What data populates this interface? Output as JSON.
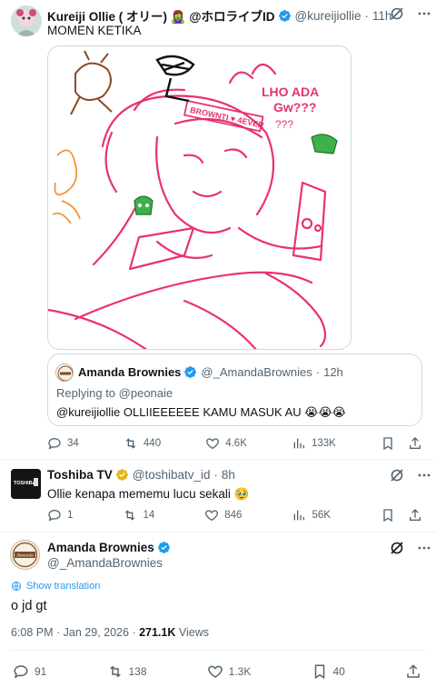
{
  "tweet1": {
    "name": "Kureiji Ollie ( オリー) 🧟‍♀️ @ホロライブID",
    "handle": "@kureijiollie",
    "time": "11h",
    "text": "MOMEN KETIKA",
    "image_texts": {
      "speech": "LHO ADA",
      "speech2": "Gw???",
      "question": "???",
      "headband": "BROWNTI ♥ 4EVER"
    },
    "quote": {
      "name": "Amanda Brownies",
      "handle": "@_AmandaBrownies",
      "time": "12h",
      "reply_prefix": "Replying to ",
      "reply_to": "@peonaie",
      "text": "@kureijiollie  OLLIIEEEEEE KAMU MASUK AU 😭😭😭"
    },
    "stats": {
      "replies": "34",
      "reposts": "440",
      "likes": "4.6K",
      "views": "133K"
    }
  },
  "tweet2": {
    "name": "Toshiba TV",
    "handle": "@toshibatv_id",
    "time": "8h",
    "text": "Ollie kenapa mememu lucu sekali 🥹",
    "avatar_text": "TOSHIBA",
    "stats": {
      "replies": "1",
      "reposts": "14",
      "likes": "846",
      "views": "56K"
    }
  },
  "main": {
    "name": "Amanda Brownies",
    "handle": "@_AmandaBrownies",
    "avatar_text": "Amanda",
    "show_translation": "Show translation",
    "text": "o jd gt",
    "timestamp": "6:08 PM · Jan 29, 2026 · ",
    "views_count": "271.1K",
    "views_label": " Views",
    "stats": {
      "replies": "91",
      "reposts": "138",
      "likes": "1.3K",
      "bookmarks": "40"
    }
  },
  "colors": {
    "verified_blue": "#1d9bf0",
    "verified_gold": "#e2b719",
    "muted": "#536471",
    "link": "#1d9bf0",
    "drawing_pink": "#e8336d"
  }
}
